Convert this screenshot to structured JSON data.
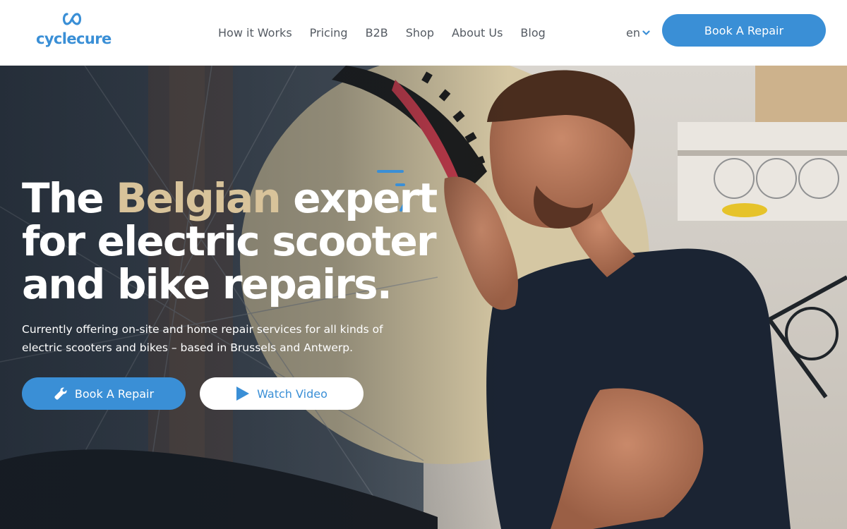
{
  "brand": {
    "name": "cyclecure",
    "logo_icon": "infinity-loop-icon",
    "color_primary": "#3a8fd6",
    "color_accent": "#d8c39a"
  },
  "nav": {
    "items": [
      {
        "label": "How it Works"
      },
      {
        "label": "Pricing"
      },
      {
        "label": "B2B"
      },
      {
        "label": "Shop"
      },
      {
        "label": "About Us"
      },
      {
        "label": "Blog"
      }
    ]
  },
  "language": {
    "selected": "en",
    "icon": "chevron-down-icon"
  },
  "header_cta": {
    "label": "Book A Repair"
  },
  "hero": {
    "title_part1": "The ",
    "title_accent": "Belgian",
    "title_part2": " expert",
    "title_line2": "for electric scooter",
    "title_line3": "and bike repairs.",
    "subtitle": "Currently offering on-site and home repair services for all kinds of electric scooters and bikes – based in Brussels and Antwerp.",
    "primary_button": {
      "label": "Book A Repair",
      "icon": "wrench-icon"
    },
    "secondary_button": {
      "label": "Watch Video",
      "icon": "play-icon"
    }
  }
}
